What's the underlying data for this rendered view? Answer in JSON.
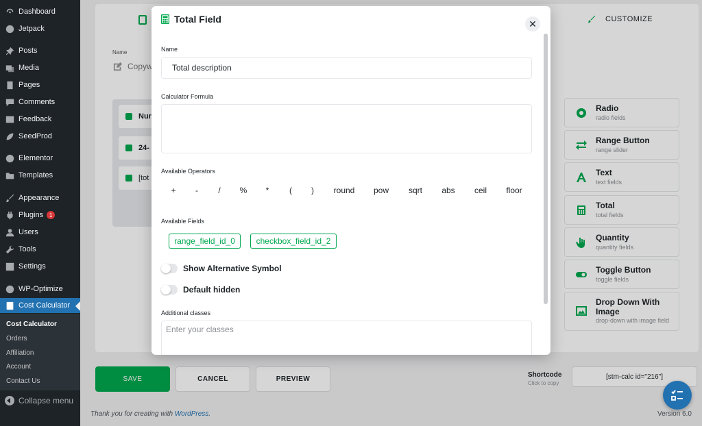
{
  "sidebar": {
    "items": [
      {
        "label": "Dashboard",
        "icon": "dashboard-icon"
      },
      {
        "label": "Jetpack",
        "icon": "jetpack-icon"
      },
      {
        "label": "Posts",
        "icon": "pin-icon"
      },
      {
        "label": "Media",
        "icon": "media-icon"
      },
      {
        "label": "Pages",
        "icon": "pages-icon"
      },
      {
        "label": "Comments",
        "icon": "comments-icon"
      },
      {
        "label": "Feedback",
        "icon": "feedback-icon"
      },
      {
        "label": "SeedProd",
        "icon": "seedprod-icon"
      },
      {
        "label": "Elementor",
        "icon": "elementor-icon"
      },
      {
        "label": "Templates",
        "icon": "folder-icon"
      },
      {
        "label": "Appearance",
        "icon": "brush-icon"
      },
      {
        "label": "Plugins",
        "icon": "plug-icon",
        "badge": "1"
      },
      {
        "label": "Users",
        "icon": "users-icon"
      },
      {
        "label": "Tools",
        "icon": "wrench-icon"
      },
      {
        "label": "Settings",
        "icon": "settings-icon"
      },
      {
        "label": "WP-Optimize",
        "icon": "optimize-icon"
      },
      {
        "label": "Cost Calculator",
        "icon": "calculator-icon"
      }
    ],
    "submenu": [
      "Cost Calculator",
      "Orders",
      "Affiliation",
      "Account",
      "Contact Us"
    ],
    "collapse_label": "Collapse menu"
  },
  "background": {
    "customize_tab": "CUSTOMIZE",
    "name_label": "Name",
    "name_value": "Copyw",
    "list_rows": [
      "Nur",
      "24-",
      "[tot"
    ],
    "elements": [
      {
        "title": "Radio",
        "sub": "radio fields",
        "icon": "radio-icon"
      },
      {
        "title": "Range Button",
        "sub": "range slider",
        "icon": "range-icon"
      },
      {
        "title": "Text",
        "sub": "text fields",
        "icon": "text-icon"
      },
      {
        "title": "Total",
        "sub": "total fields",
        "icon": "calculator-icon"
      },
      {
        "title": "Quantity",
        "sub": "quantity fields",
        "icon": "hand-icon"
      },
      {
        "title": "Toggle Button",
        "sub": "toggle fields",
        "icon": "toggle-icon"
      },
      {
        "title": "Drop Down With Image",
        "sub": "drop-down with image field",
        "icon": "image-icon"
      }
    ],
    "save_label": "SAVE",
    "cancel_label": "CANCEL",
    "preview_label": "PREVIEW",
    "shortcode_label": "Shortcode",
    "shortcode_sub": "Click to copy",
    "shortcode_value": "[stm-calc id=\"216\"]",
    "footer_prefix": "Thank you for creating with ",
    "footer_link": "WordPress",
    "footer_suffix": ".",
    "version": "Version 6.0"
  },
  "modal": {
    "title": "Total Field",
    "close": "✕",
    "name_label": "Name",
    "name_value": "Total description",
    "formula_label": "Calculator Formula",
    "formula_value": "",
    "operators_label": "Available Operators",
    "operators": [
      "+",
      "-",
      "/",
      "%",
      "*",
      "(",
      ")",
      "round",
      "pow",
      "sqrt",
      "abs",
      "ceil",
      "floor"
    ],
    "fields_label": "Available Fields",
    "fields": [
      "range_field_id_0",
      "checkbox_field_id_2"
    ],
    "toggle_alt_symbol": "Show Alternative Symbol",
    "toggle_default_hidden": "Default hidden",
    "classes_label": "Additional classes",
    "classes_placeholder": "Enter your classes"
  },
  "colors": {
    "accent_green": "#00a84f",
    "wp_blue": "#2271b1",
    "sidebar_bg": "#1d2327"
  }
}
